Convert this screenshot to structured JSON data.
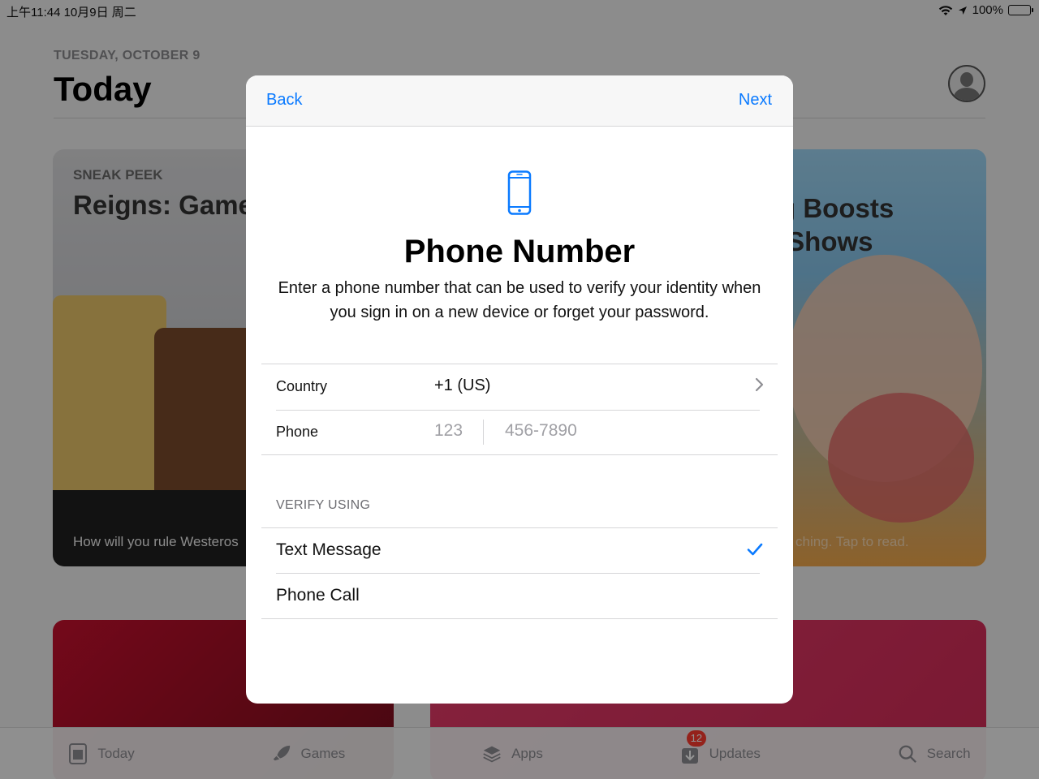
{
  "status_bar": {
    "time_date": "上午11:44   10月9日 周二",
    "battery": "100%"
  },
  "background": {
    "date": "TUESDAY, OCTOBER 9",
    "title": "Today",
    "card_left": {
      "eyebrow": "SNEAK PEEK",
      "headline": "Reigns: Game",
      "foot": "How will you rule Westeros"
    },
    "card_right": {
      "headline": "g Boosts\n Shows",
      "foot": "ching. Tap to read."
    }
  },
  "tab_bar": {
    "items": [
      {
        "label": "Today",
        "icon": "today-icon"
      },
      {
        "label": "Games",
        "icon": "rocket-icon"
      },
      {
        "label": "Apps",
        "icon": "layers-icon"
      },
      {
        "label": "Updates",
        "icon": "download-icon",
        "badge": "12"
      },
      {
        "label": "Search",
        "icon": "search-icon"
      }
    ]
  },
  "modal": {
    "back_label": "Back",
    "next_label": "Next",
    "icon": "iphone-icon",
    "title": "Phone Number",
    "description": "Enter a phone number that can be used to verify your identity when you sign in on a new device or forget your password.",
    "country_label": "Country",
    "country_value": "+1 (US)",
    "phone_label": "Phone",
    "phone_area_placeholder": "123",
    "phone_number_placeholder": "456-7890",
    "verify_header": "VERIFY USING",
    "options": [
      {
        "label": "Text Message",
        "selected": true
      },
      {
        "label": "Phone Call",
        "selected": false
      }
    ],
    "accent_color": "#0a7aff"
  }
}
